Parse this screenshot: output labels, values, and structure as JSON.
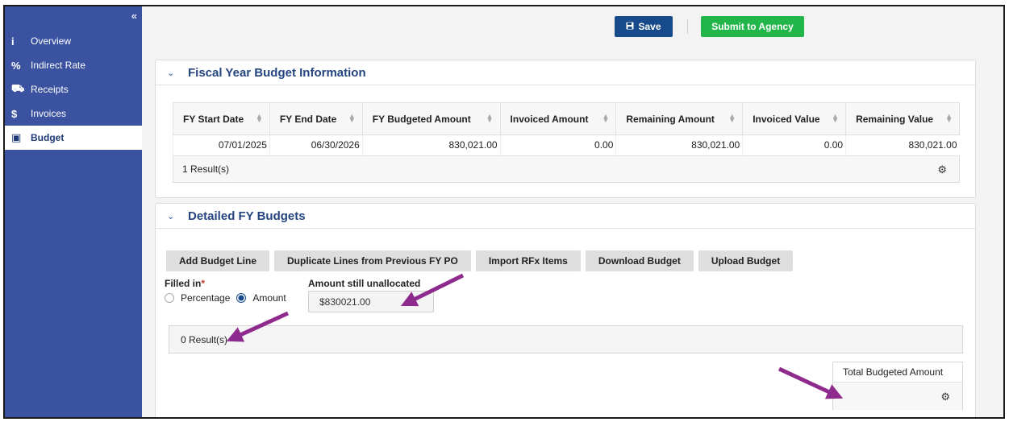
{
  "sidebar": {
    "collapse_icon": "«",
    "items": [
      {
        "icon": "i",
        "label": "Overview"
      },
      {
        "icon": "%",
        "label": "Indirect Rate"
      },
      {
        "icon": "⛟",
        "label": "Receipts"
      },
      {
        "icon": "$",
        "label": "Invoices"
      },
      {
        "icon": "▣",
        "label": "Budget"
      }
    ],
    "active_index": 4
  },
  "toolbar": {
    "save_label": "Save",
    "submit_label": "Submit to Agency",
    "save_color": "#174a8b",
    "submit_color": "#22b54a"
  },
  "fy_panel": {
    "title": "Fiscal Year Budget Information",
    "columns": [
      "FY Start Date",
      "FY End Date",
      "FY Budgeted Amount",
      "Invoiced Amount",
      "Remaining Amount",
      "Invoiced Value",
      "Remaining Value"
    ],
    "rows": [
      [
        "07/01/2025",
        "06/30/2026",
        "830,021.00",
        "0.00",
        "830,021.00",
        "0.00",
        "830,021.00"
      ]
    ],
    "results": "1 Result(s)"
  },
  "detail_panel": {
    "title": "Detailed FY Budgets",
    "actions": [
      "Add Budget Line",
      "Duplicate Lines from Previous FY PO",
      "Import RFx Items",
      "Download Budget",
      "Upload Budget"
    ],
    "filled_in_label": "Filled in",
    "required_mark": "*",
    "options": [
      "Percentage",
      "Amount"
    ],
    "selected_option": "Amount",
    "unallocated_label": "Amount still unallocated",
    "unallocated_value": "$830021.00",
    "results": "0 Result(s)",
    "total_header": "Total Budgeted Amount"
  },
  "annotation_color": "#8e2a8e"
}
